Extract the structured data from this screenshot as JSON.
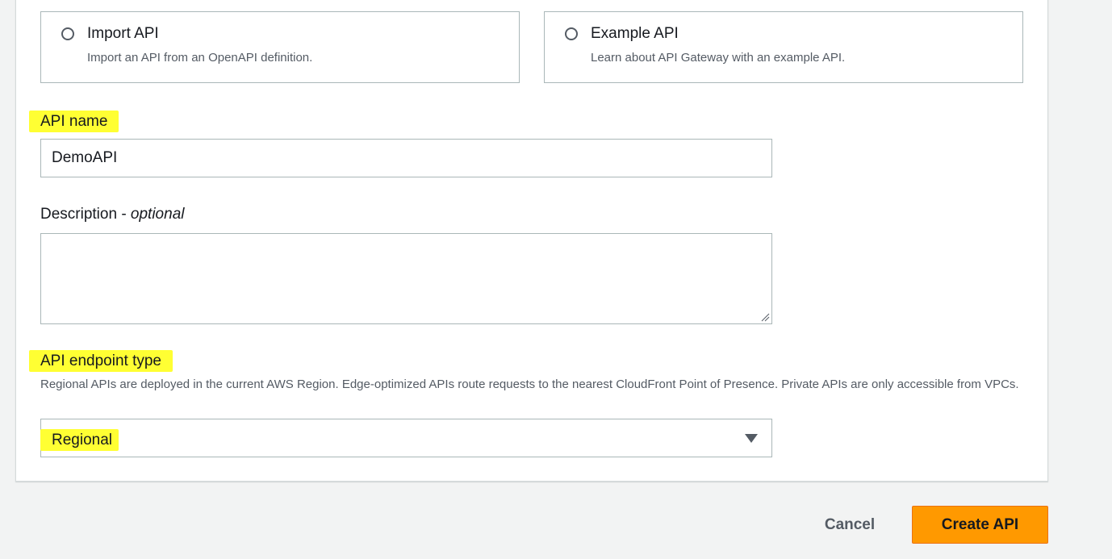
{
  "api_type_options": [
    {
      "title": "Import API",
      "description": "Import an API from an OpenAPI definition."
    },
    {
      "title": "Example API",
      "description": "Learn about API Gateway with an example API."
    }
  ],
  "api_name": {
    "label": "API name",
    "value": "DemoAPI"
  },
  "description": {
    "label": "Description - ",
    "optional_label": "optional",
    "value": ""
  },
  "endpoint_type": {
    "label": "API endpoint type",
    "help_text": "Regional APIs are deployed in the current AWS Region. Edge-optimized APIs route requests to the nearest CloudFront Point of Presence. Private APIs are only accessible from VPCs.",
    "selected": "Regional"
  },
  "actions": {
    "cancel_label": "Cancel",
    "create_label": "Create API"
  },
  "colors": {
    "highlight": "#ffff33",
    "primary_button": "#ff9900",
    "page_background": "#f2f3f3"
  },
  "icons": {
    "radio": "radio-unchecked-icon",
    "select_caret": "caret-down-icon",
    "resize": "resize-handle-icon"
  }
}
